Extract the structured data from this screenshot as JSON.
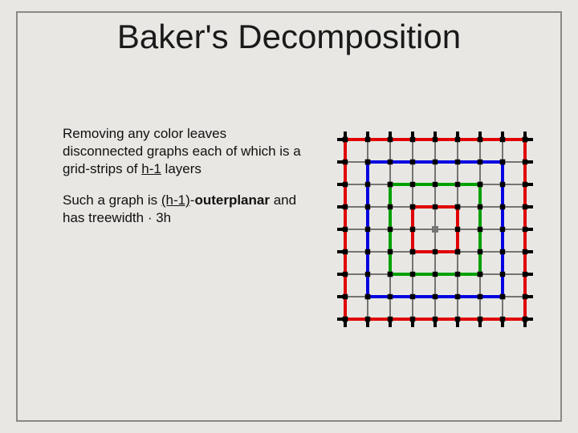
{
  "title": "Baker's Decomposition",
  "para1_a": "Removing any color leaves disconnected graphs each of which is a grid-strips of ",
  "para1_b": "h-1",
  "para1_c": " layers",
  "para2_a": "Such a graph is ",
  "para2_b": "(h-1)",
  "para2_c": "-",
  "para2_d": "outerplanar",
  "para2_e": " and has treewidth · 3h",
  "figure": {
    "grid_size": 9,
    "cell": 28,
    "rings": [
      {
        "index": 0,
        "color": "#e00000"
      },
      {
        "index": 1,
        "color": "#0000e0"
      },
      {
        "index": 2,
        "color": "#00a000"
      },
      {
        "index": 3,
        "color": "#e00000"
      }
    ],
    "center": {
      "index": 4,
      "color": "#757575"
    }
  }
}
